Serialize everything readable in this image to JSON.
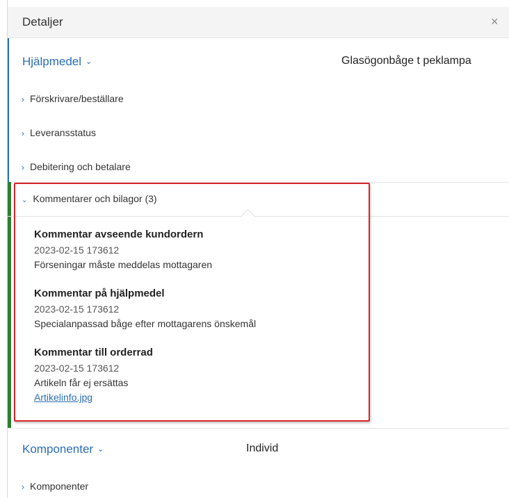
{
  "header": {
    "title": "Detaljer",
    "close_label": "×"
  },
  "section_hjalpmedel": {
    "label": "Hjälpmedel",
    "value": "Glasögonbåge t peklampa"
  },
  "accordion": {
    "forskrivare": "Förskrivare/beställare",
    "leveransstatus": "Leveransstatus",
    "debitering": "Debitering och betalare",
    "kommentarer": "Kommentarer och bilagor  (3)"
  },
  "comments": [
    {
      "title": "Kommentar avseende kundordern",
      "date": "2023-02-15 173612",
      "text": "Förseningar måste meddelas mottagaren"
    },
    {
      "title": "Kommentar på hjälpmedel",
      "date": "2023-02-15 173612",
      "text": "Specialanpassad båge efter mottagarens önskemål"
    },
    {
      "title": "Kommentar till orderrad",
      "date": "2023-02-15 173612",
      "text": "Artikeln får ej ersättas",
      "attachment": "Artikelinfo.jpg"
    }
  ],
  "section_komponenter": {
    "label": "Komponenter",
    "value": "Individ",
    "item": "Komponenter"
  },
  "icons": {
    "expand": "chevron-right-icon",
    "collapse": "chevron-down-icon",
    "close": "close-icon"
  },
  "colors": {
    "accent": "#2a6db5",
    "highlight": "#d9242b",
    "active_bar": "#2e7d32"
  }
}
